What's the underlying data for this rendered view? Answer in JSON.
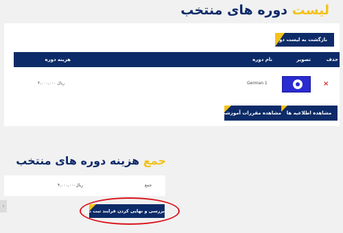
{
  "page": {
    "title_accent": "لیست",
    "title_main": "دوره های منتخب"
  },
  "selected": {
    "back_button": "بازگشت به لیست دوره ها",
    "columns": {
      "delete": "حذف",
      "image": "تصویر",
      "name": "نام دوره",
      "cost": "هزینه دوره"
    },
    "rows": [
      {
        "name": "German 1",
        "price": "۴,۰۰۰,۰۰۰ ریال",
        "delete_icon": "×"
      }
    ],
    "view_announcements": "مشاهده اطلاعیه ها",
    "view_rules": "مشاهده مقررات آموزشی"
  },
  "summary": {
    "title_accent": "جمع",
    "title_main": "هزینه دوره های منتخب",
    "label": "جمع",
    "value": "۴,۰۰۰,۰۰۰ریال",
    "submit": "بررسی و نهایی کردن فرایند ثبت نام"
  },
  "icons": {
    "scroll_top": "‹"
  },
  "colors": {
    "navy": "#0d2b68",
    "accent": "#f3c21a",
    "delete": "#e02727",
    "highlight_circle": "#d9131a"
  }
}
